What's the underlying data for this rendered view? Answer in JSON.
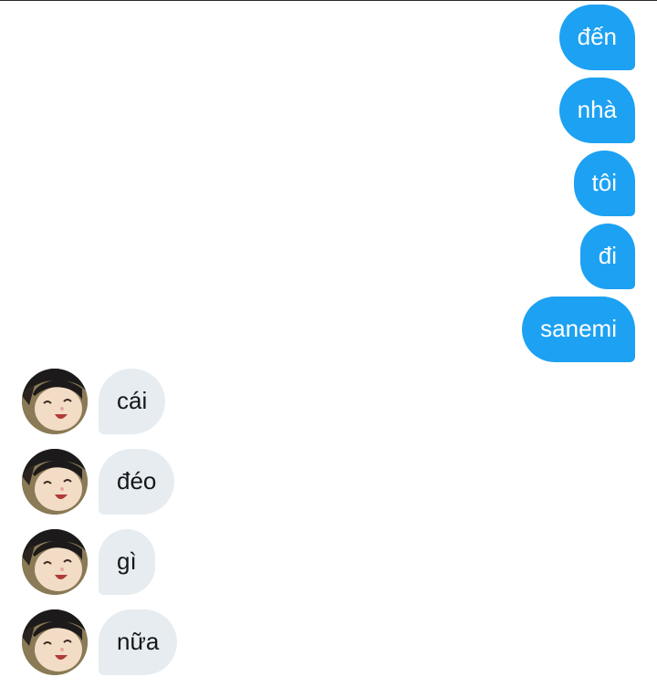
{
  "conversation": {
    "outgoing": [
      {
        "text": "đến"
      },
      {
        "text": "nhà"
      },
      {
        "text": "tôi"
      },
      {
        "text": "đi"
      },
      {
        "text": "sanemi"
      }
    ],
    "incoming": [
      {
        "text": "cái"
      },
      {
        "text": "đéo"
      },
      {
        "text": "gì"
      },
      {
        "text": "nữa"
      }
    ]
  },
  "colors": {
    "outgoing_bubble": "#1da1f2",
    "incoming_bubble": "#e6ecf0",
    "outgoing_text": "#ffffff",
    "incoming_text": "#14171a"
  },
  "icons": {
    "avatar": "anime-character-avatar"
  }
}
